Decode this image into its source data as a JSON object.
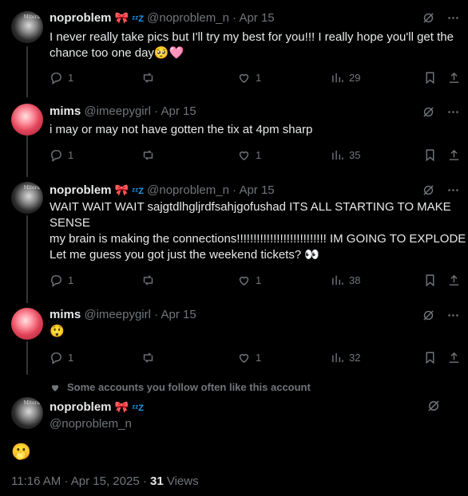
{
  "tweets": [
    {
      "name": "noproblem",
      "handle": "@noproblem_n",
      "dot": "·",
      "date": "Apr 15",
      "lines": [
        "I never really take pics but I'll try my best for you!!! I really hope you'll get the",
        "chance too one day🥺🩷"
      ],
      "replies": "1",
      "likes": "1",
      "views": "29"
    },
    {
      "name": "mims",
      "handle": "@imeepygirl",
      "dot": "·",
      "date": "Apr 15",
      "lines": [
        "i may or may not have gotten the tix at 4pm sharp"
      ],
      "replies": "1",
      "likes": "1",
      "views": "35"
    },
    {
      "name": "noproblem",
      "handle": "@noproblem_n",
      "dot": "·",
      "date": "Apr 15",
      "lines": [
        "WAIT WAIT WAIT sajgtdlhgljrdfsahjgofushad ITS ALL STARTING TO MAKE",
        "SENSE",
        "my brain is making the connections!!!!!!!!!!!!!!!!!!!!!!!!!!! IM GOING TO EXPLODE",
        "Let me guess you got just the weekend tickets? 👀"
      ],
      "replies": "1",
      "likes": "1",
      "views": "38"
    },
    {
      "name": "mims",
      "handle": "@imeepygirl",
      "dot": "·",
      "date": "Apr 15",
      "lines": [
        "😲"
      ],
      "replies": "1",
      "likes": "1",
      "views": "32"
    }
  ],
  "social_context": "Some accounts you follow often like this account",
  "focused": {
    "name": "noproblem",
    "handle": "@noproblem_n",
    "text": "🫢",
    "time": "11:16 AM · Apr 15, 2025 · ",
    "views_count": "31",
    "views_label": " Views"
  },
  "decor": {
    "ribbon": "🎀",
    "zz": "ᶻᶻZ",
    "avatar_badge": "Mitera"
  },
  "icons": [
    "reply-icon",
    "retweet-icon",
    "like-icon",
    "views-icon",
    "bookmark-icon",
    "share-icon",
    "grok-icon"
  ]
}
